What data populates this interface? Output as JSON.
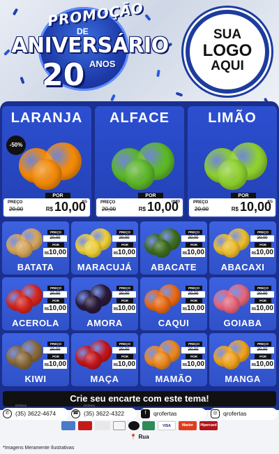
{
  "header": {
    "promo_title": "PROMOÇÃO",
    "promo_de": "DE",
    "promo_aniversario": "ANIVERSÁRIO",
    "promo_number": "20",
    "promo_anos": "ANOS",
    "logo_line1": "SUA",
    "logo_line2": "LOGO",
    "logo_line3": "AQUI"
  },
  "featured": [
    {
      "name": "LARANJA",
      "discount": "-50%",
      "preco_label": "PREÇO",
      "old_price": "20,00",
      "por_label": "POR",
      "currency": "R$",
      "new_price": "10,00",
      "unit": "KG",
      "color": "#f58a07"
    },
    {
      "name": "ALFACE",
      "preco_label": "PREÇO",
      "old_price": "20,00",
      "por_label": "POR",
      "currency": "R$",
      "new_price": "10,00",
      "unit": "UNID",
      "color": "#5db829"
    },
    {
      "name": "LIMÃO",
      "preco_label": "PREÇO",
      "old_price": "20,00",
      "por_label": "POR",
      "currency": "R$",
      "new_price": "10,00",
      "unit": "KG",
      "color": "#8fd12e"
    }
  ],
  "products": [
    {
      "name": "BATATA",
      "old_price": "20,00",
      "new_price": "10,00",
      "color": "#d9a85a"
    },
    {
      "name": "MARACUJÁ",
      "old_price": "20,00",
      "new_price": "10,00",
      "color": "#f2d23a"
    },
    {
      "name": "ABACATE",
      "old_price": "20,00",
      "new_price": "10,00",
      "color": "#3f6e1e"
    },
    {
      "name": "ABACAXI",
      "old_price": "20,00",
      "new_price": "10,00",
      "color": "#f1c12e"
    },
    {
      "name": "ACEROLA",
      "old_price": "20,00",
      "new_price": "10,00",
      "color": "#d8261d"
    },
    {
      "name": "AMORA",
      "old_price": "20,00",
      "new_price": "10,00",
      "color": "#2a1a3a"
    },
    {
      "name": "CAQUI",
      "old_price": "20,00",
      "new_price": "10,00",
      "color": "#ee6b12"
    },
    {
      "name": "GOIABA",
      "old_price": "20,00",
      "new_price": "10,00",
      "color": "#e9677c"
    },
    {
      "name": "KIWI",
      "old_price": "20,00",
      "new_price": "10,00",
      "color": "#8a6a3a"
    },
    {
      "name": "MAÇA",
      "old_price": "20,00",
      "new_price": "10,00",
      "color": "#c8161c"
    },
    {
      "name": "MAMÃO",
      "old_price": "20,00",
      "new_price": "10,00",
      "color": "#f08a1e"
    },
    {
      "name": "MANGA",
      "old_price": "20,00",
      "new_price": "10,00",
      "color": "#f4a51e"
    }
  ],
  "small_labels": {
    "preco": "PREÇO",
    "por": "POR",
    "currency": "R$"
  },
  "cta": "Crie seu encarte com este tema!",
  "contacts": [
    {
      "icon": "whatsapp-icon",
      "sub": "Delivery",
      "text": "(35) 3622-4674"
    },
    {
      "icon": "phone-icon",
      "sub": "Delivery",
      "text": "(35) 3622-4322"
    },
    {
      "icon": "facebook-icon",
      "text": "qrofertas"
    },
    {
      "icon": "instagram-icon",
      "text": "qrofertas"
    }
  ],
  "payments": [
    "VISA",
    "Master",
    "Hipercard"
  ],
  "address": "Rua",
  "disclaimer": "*Imagens Meramente Ilustrativas"
}
